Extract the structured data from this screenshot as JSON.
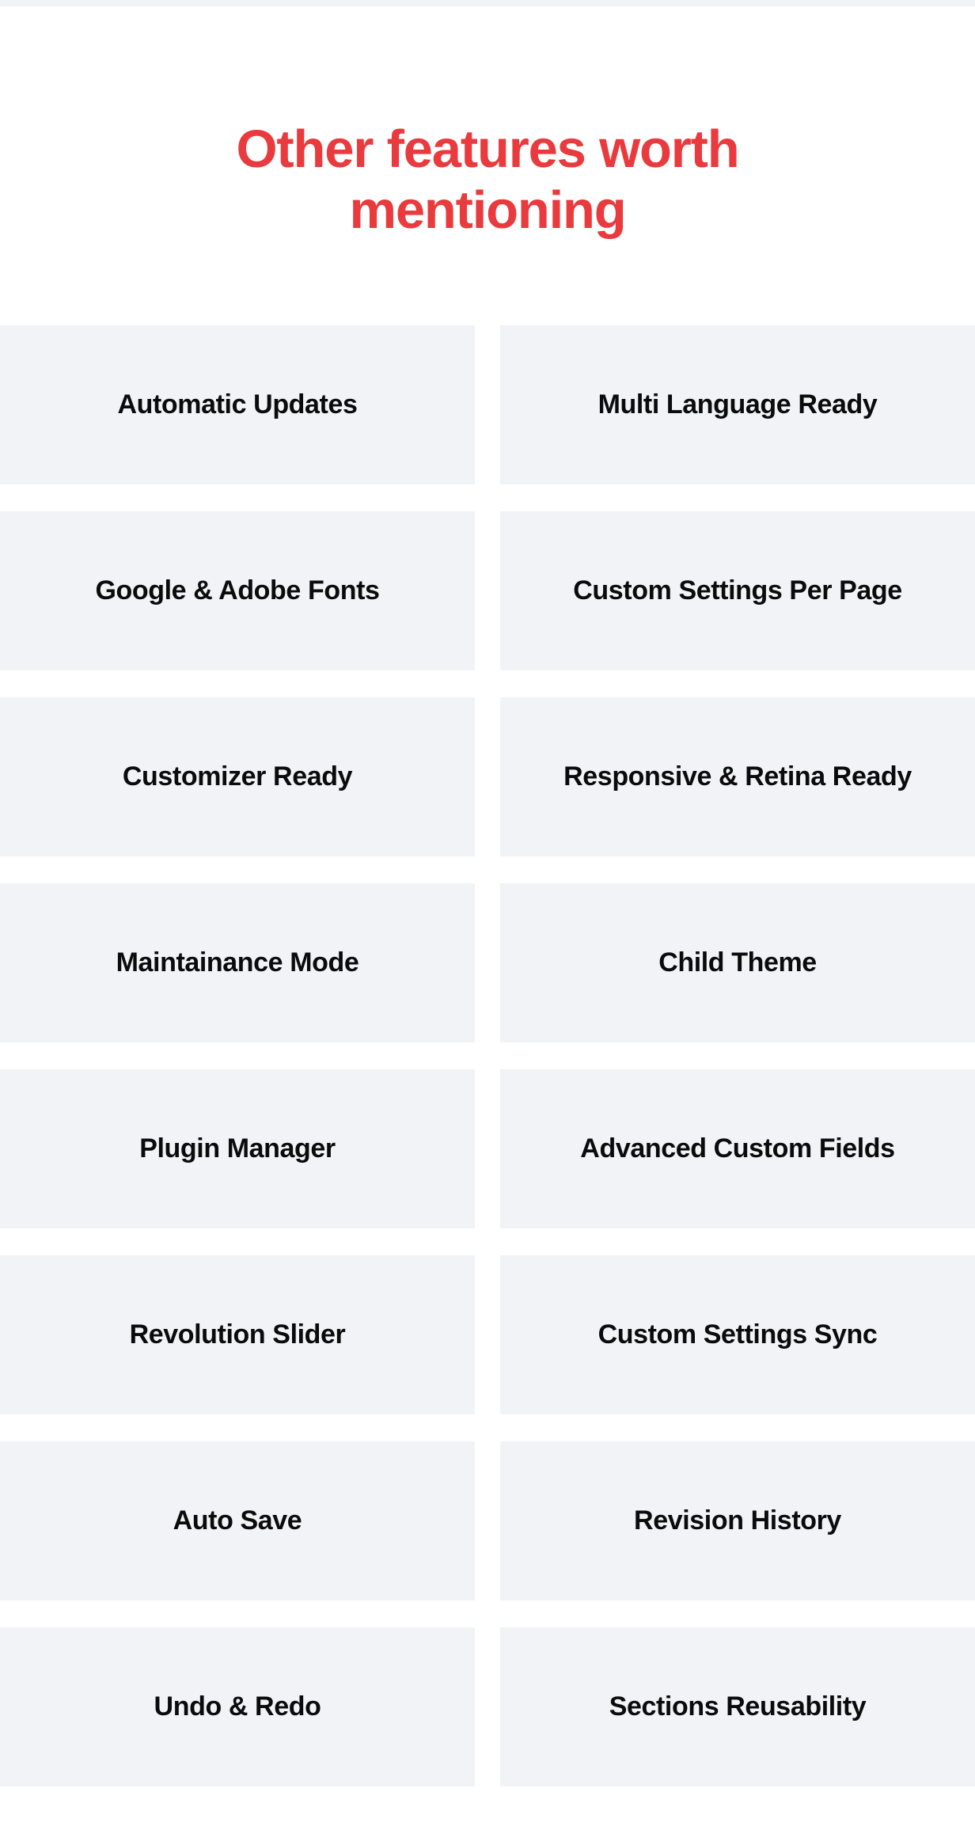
{
  "section": {
    "heading": "Other features worth mentioning",
    "heading_line_1": "Other features worth",
    "heading_line_2": "mentioning",
    "heading_color": "#e93a3e"
  },
  "theme": {
    "page_background": "#ffffff",
    "card_background": "#f2f3f6",
    "card_text_color": "#0b0b0d",
    "accent_color": "#e93a3e",
    "top_strip_color": "#f1f2f5"
  },
  "features": [
    {
      "label": "Automatic Updates"
    },
    {
      "label": "Multi Language Ready"
    },
    {
      "label": "Google & Adobe Fonts"
    },
    {
      "label": "Custom Settings Per Page"
    },
    {
      "label": "Customizer Ready"
    },
    {
      "label": "Responsive & Retina Ready"
    },
    {
      "label": "Maintainance Mode"
    },
    {
      "label": "Child Theme"
    },
    {
      "label": "Plugin Manager"
    },
    {
      "label": "Advanced Custom Fields"
    },
    {
      "label": "Revolution Slider"
    },
    {
      "label": "Custom Settings Sync"
    },
    {
      "label": "Auto Save"
    },
    {
      "label": "Revision History"
    },
    {
      "label": "Undo & Redo"
    },
    {
      "label": "Sections Reusability"
    }
  ]
}
